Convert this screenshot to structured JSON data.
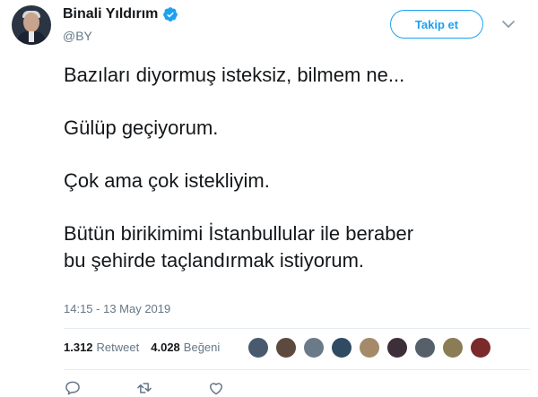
{
  "author": {
    "name": "Binali Yıldırım",
    "handle": "@BY",
    "verified": true
  },
  "follow_button": {
    "label": "Takip et"
  },
  "tweet": {
    "lines": [
      "Bazıları diyormuş isteksiz, bilmem ne...",
      "Gülüp geçiyorum.",
      "Çok ama çok istekliyim.",
      "Bütün birikimimi İstanbullular ile beraber",
      "bu şehirde taçlandırmak istiyorum."
    ]
  },
  "timestamp": "14:15 - 13 May 2019",
  "stats": {
    "retweets": "1.312",
    "retweets_label": "Retweet",
    "likes": "4.028",
    "likes_label": "Beğeni"
  },
  "likers": [
    {
      "color": "#4a5a6e"
    },
    {
      "color": "#5c4a3e"
    },
    {
      "color": "#6b7a88"
    },
    {
      "color": "#2f4a63"
    },
    {
      "color": "#a58a6a"
    },
    {
      "color": "#3d2f3a"
    },
    {
      "color": "#55606b"
    },
    {
      "color": "#8a7d55"
    },
    {
      "color": "#7a2a2a"
    }
  ],
  "colors": {
    "accent": "#1da1f2",
    "muted": "#657786",
    "text": "#14171a"
  }
}
